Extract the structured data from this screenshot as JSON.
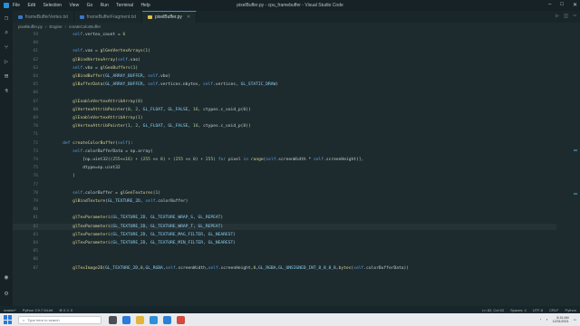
{
  "titlebar": {
    "menu": [
      "File",
      "Edit",
      "Selection",
      "View",
      "Go",
      "Run",
      "Terminal",
      "Help"
    ],
    "title": "pixelBuffer.py - cpu_framebuffer - Visual Studio Code"
  },
  "tabs": [
    {
      "label": "frameBufferVertex.txt",
      "active": false
    },
    {
      "label": "frameBufferFragment.txt",
      "active": false
    },
    {
      "label": "pixelBuffer.py",
      "active": true
    }
  ],
  "breadcrumb": [
    "pixelBuffer.py",
    "Engine",
    "createColorBuffer"
  ],
  "editor": {
    "lines": [
      {
        "n": "59",
        "t": "        self.vertex_count = 6"
      },
      {
        "n": "60",
        "t": ""
      },
      {
        "n": "61",
        "t": "        self.vao = glGenVertexArrays(1)"
      },
      {
        "n": "62",
        "t": "        glBindVertexArray(self.vao)"
      },
      {
        "n": "63",
        "t": "        self.vbo = glGenBuffers(1)"
      },
      {
        "n": "64",
        "t": "        glBindBuffer(GL_ARRAY_BUFFER, self.vbo)"
      },
      {
        "n": "65",
        "t": "        glBufferData(GL_ARRAY_BUFFER, self.vertices.nbytes, self.vertices, GL_STATIC_DRAW)"
      },
      {
        "n": "66",
        "t": ""
      },
      {
        "n": "67",
        "t": "        glEnableVertexAttribArray(0)"
      },
      {
        "n": "68",
        "t": "        glVertexAttribPointer(0, 2, GL_FLOAT, GL_FALSE, 16, ctypes.c_void_p(0))"
      },
      {
        "n": "69",
        "t": "        glEnableVertexAttribArray(1)"
      },
      {
        "n": "70",
        "t": "        glVertexAttribPointer(1, 2, GL_FLOAT, GL_FALSE, 16, ctypes.c_void_p(8))"
      },
      {
        "n": "71",
        "t": ""
      },
      {
        "n": "72",
        "t": "    def createColorBuffer(self):"
      },
      {
        "n": "73",
        "t": "        self.colorBufferData = np.array("
      },
      {
        "n": "74",
        "t": "            [np.uint32((255<<16) + (255 << 8) + (255 << 0) + 255) for pixel in range(self.screenWidth * self.screenHeight)],"
      },
      {
        "n": "75",
        "t": "            dtype=np.uint32"
      },
      {
        "n": "76",
        "t": "        )"
      },
      {
        "n": "77",
        "t": ""
      },
      {
        "n": "78",
        "t": "        self.colorBuffer = glGenTextures(1)"
      },
      {
        "n": "79",
        "t": "        glBindTexture(GL_TEXTURE_2D, self.colorBuffer)"
      },
      {
        "n": "80",
        "t": ""
      },
      {
        "n": "81",
        "t": "        glTexParameteri(GL_TEXTURE_2D, GL_TEXTURE_WRAP_S, GL_REPEAT)"
      },
      {
        "n": "82",
        "t": "        glTexParameteri(GL_TEXTURE_2D, GL_TEXTURE_WRAP_T, GL_REPEAT)"
      },
      {
        "n": "83",
        "t": "        glTexParameteri(GL_TEXTURE_2D, GL_TEXTURE_MAG_FILTER, GL_NEAREST)"
      },
      {
        "n": "84",
        "t": "        glTexParameteri(GL_TEXTURE_2D, GL_TEXTURE_MIN_FILTER, GL_NEAREST)"
      },
      {
        "n": "85",
        "t": ""
      },
      {
        "n": "86",
        "t": ""
      },
      {
        "n": "87",
        "t": "        glTexImage2D(GL_TEXTURE_2D,0,GL_RGBA,self.screenWidth,self.screenHeight,0,GL_RGBA,GL_UNSIGNED_INT_8_8_8_8,bytes(self.colorBufferData))"
      }
    ]
  },
  "statusbar": {
    "left": [
      "master*",
      "Python 3.9.7 64-bit",
      "⊗ 0  ⚠ 0"
    ],
    "right": [
      "Ln 82, Col 63",
      "Spaces: 4",
      "UTF-8",
      "CRLF",
      "Python"
    ]
  },
  "taskbar": {
    "search_placeholder": "Type here to search",
    "time": "8:15 AM",
    "date": "12/31/2021"
  },
  "colors": {
    "editor_bg": "#1e2b2e",
    "accent": "#3d8fd1"
  }
}
